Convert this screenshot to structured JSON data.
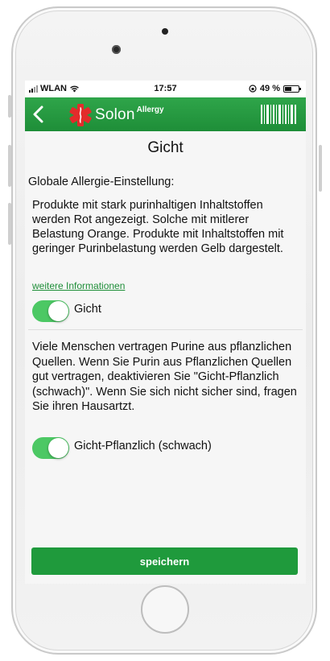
{
  "status_bar": {
    "carrier": "WLAN",
    "time": "17:57",
    "battery_percent": "49 %",
    "battery_level": 0.49
  },
  "header": {
    "brand_name": "Solon",
    "brand_superscript": "Allergy",
    "back_icon": "chevron-left-icon",
    "barcode_icon": "barcode-icon",
    "background_color": "#1e8e38",
    "logo_color": "#e32b2b"
  },
  "page": {
    "title": "Gicht",
    "section_heading": "Globale Allergie-Einstellung:",
    "description": "Produkte mit  stark purinhaltigen Inhaltstoffen werden Rot angezeigt. Solche mit mitlerer Belastung Orange.  Produkte mit Inhaltstoffen mit geringer Purinbelastung werden Gelb dargestelt.",
    "info_link": "weitere Informationen",
    "toggles": [
      {
        "label": "Gicht",
        "on": true
      },
      {
        "label": "Gicht-Pflanzlich (schwach)",
        "on": true
      }
    ],
    "plant_description": "Viele Menschen vertragen Purine aus pflanzlichen Quellen. Wenn Sie Purin aus Pflanzlichen Quellen gut vertragen, deaktivieren Sie \"Gicht-Pflanzlich (schwach)\". Wenn Sie sich nicht sicher sind, fragen Sie ihren Hausartzt.",
    "save_label": "speichern"
  },
  "colors": {
    "accent_green": "#1f9a3c",
    "toggle_on": "#4cc864"
  }
}
